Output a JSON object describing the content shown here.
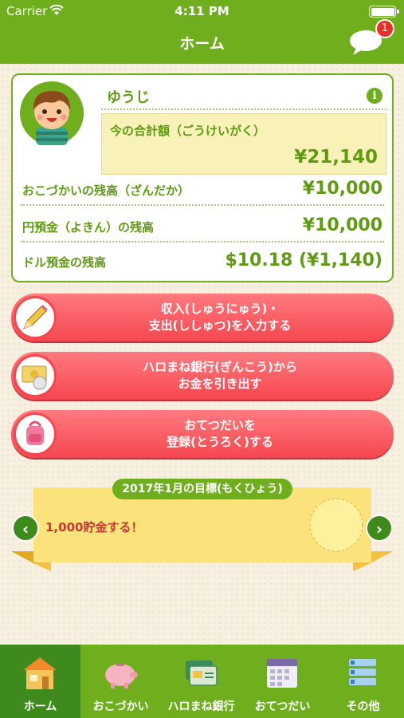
{
  "status_bar": {
    "carrier": "Carrier",
    "time": "4:11 PM"
  },
  "nav": {
    "title": "ホーム",
    "chat_badge": "1"
  },
  "summary": {
    "user_name": "ゆうじ",
    "info_icon": "i",
    "total_label": "今の合計額（ごうけいがく）",
    "total_value": "¥21,140",
    "rows": [
      {
        "label": "おこづかいの残高（ざんだか）",
        "value": "¥10,000"
      },
      {
        "label": "円預金（よきん）の残高",
        "value": "¥10,000"
      },
      {
        "label": "ドル預金の残高",
        "value": "$10.18 (¥1,140)"
      }
    ]
  },
  "actions": [
    {
      "line1": "収入(しゅうにゅう)・",
      "line2": "支出(ししゅつ)を入力する",
      "icon": "pencil-icon"
    },
    {
      "line1": "ハロまね銀行(ぎんこう)から",
      "line2": "お金を引き出す",
      "icon": "money-icon"
    },
    {
      "line1": "おてつだいを",
      "line2": "登録(とうろく)する",
      "icon": "backpack-icon"
    }
  ],
  "goal": {
    "title": "2017年1月の目標(もくひょう)",
    "text": "1,000貯金する！",
    "prev": "‹",
    "next": "›"
  },
  "tabs": [
    {
      "label": "ホーム",
      "icon": "house-icon",
      "active": true
    },
    {
      "label": "おこづかい",
      "icon": "piggy-bank-icon",
      "active": false
    },
    {
      "label": "ハロまね銀行",
      "icon": "bank-card-icon",
      "active": false
    },
    {
      "label": "おてつだい",
      "icon": "calendar-icon",
      "active": false
    },
    {
      "label": "その他",
      "icon": "list-icon",
      "active": false
    }
  ],
  "colors": {
    "brand_green": "#6fae1c",
    "dark_green": "#3f8a1c",
    "button_red": "#f6474f",
    "badge_red": "#e8302a"
  }
}
